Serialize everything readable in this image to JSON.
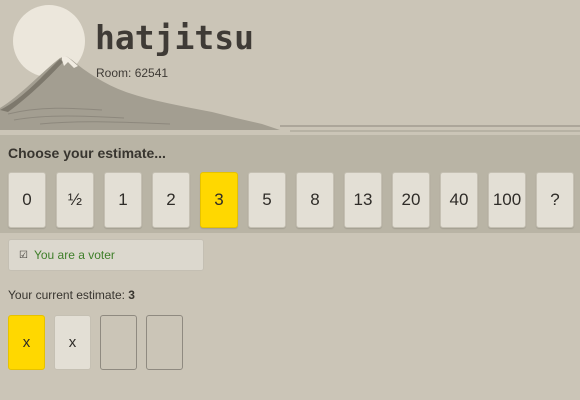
{
  "app": {
    "title": "hatjitsu",
    "room_label": "Room:",
    "room_id": "62541"
  },
  "estimate": {
    "heading": "Choose your estimate...",
    "cards": [
      "0",
      "½",
      "1",
      "2",
      "3",
      "5",
      "8",
      "13",
      "20",
      "40",
      "100",
      "?"
    ],
    "selected": "3"
  },
  "voter": {
    "icon": "check-icon",
    "text": "You are a voter"
  },
  "current": {
    "label": "Your current estimate:",
    "value": "3"
  },
  "votes": [
    {
      "text": "x",
      "state": "mine"
    },
    {
      "text": "x",
      "state": "other"
    },
    {
      "text": "",
      "state": "empty"
    },
    {
      "text": "",
      "state": "empty"
    }
  ],
  "colors": {
    "accent": "#ffd800",
    "voter_text": "#3f7f2a",
    "background": "#cbc5b7"
  }
}
